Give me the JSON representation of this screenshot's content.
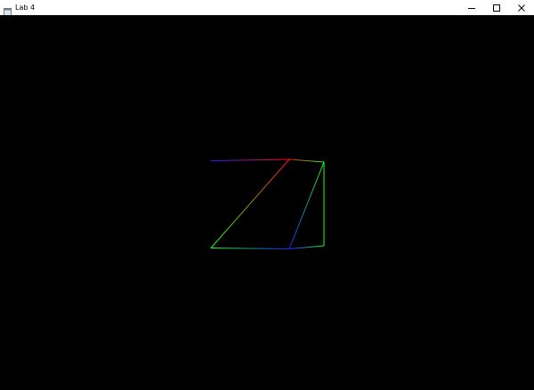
{
  "window": {
    "title": "Lab 4",
    "icon": "window-app-icon",
    "controls": {
      "minimize_icon": "minimize-icon",
      "maximize_icon": "maximize-icon",
      "close_icon": "close-icon"
    }
  },
  "canvas": {
    "background_color": "#000000",
    "line_colors": [
      "#ff0000",
      "#00ff00",
      "#0000ff"
    ]
  }
}
